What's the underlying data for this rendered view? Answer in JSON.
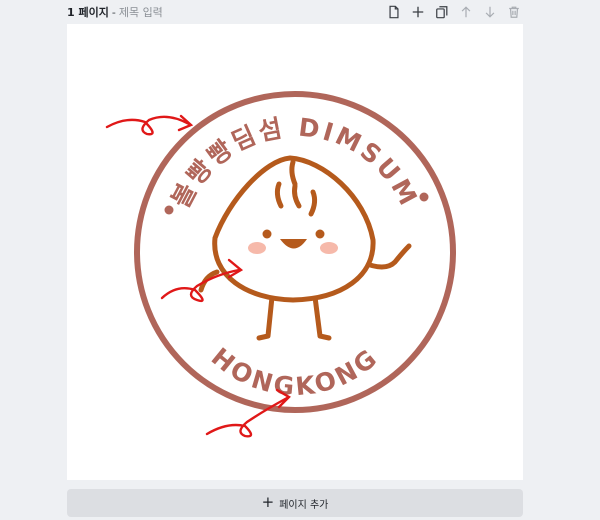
{
  "page": {
    "number_label": "1 페이지",
    "separator": "-",
    "title_placeholder": "제목 입력"
  },
  "toolbar": {
    "icons": [
      "note-icon",
      "plus-icon",
      "duplicate-icon",
      "arrow-up-icon",
      "arrow-down-icon",
      "trash-icon"
    ]
  },
  "logo": {
    "top_text": "볼빵빵딤섬 DIMSUM",
    "bottom_text": "HONGKONG",
    "colors": {
      "ring": "#b0665a",
      "bun": "#b55a1c",
      "cheek": "#f6b9aa",
      "annotation": "#e01818"
    }
  },
  "add_page": {
    "label": "페이지 추가"
  }
}
